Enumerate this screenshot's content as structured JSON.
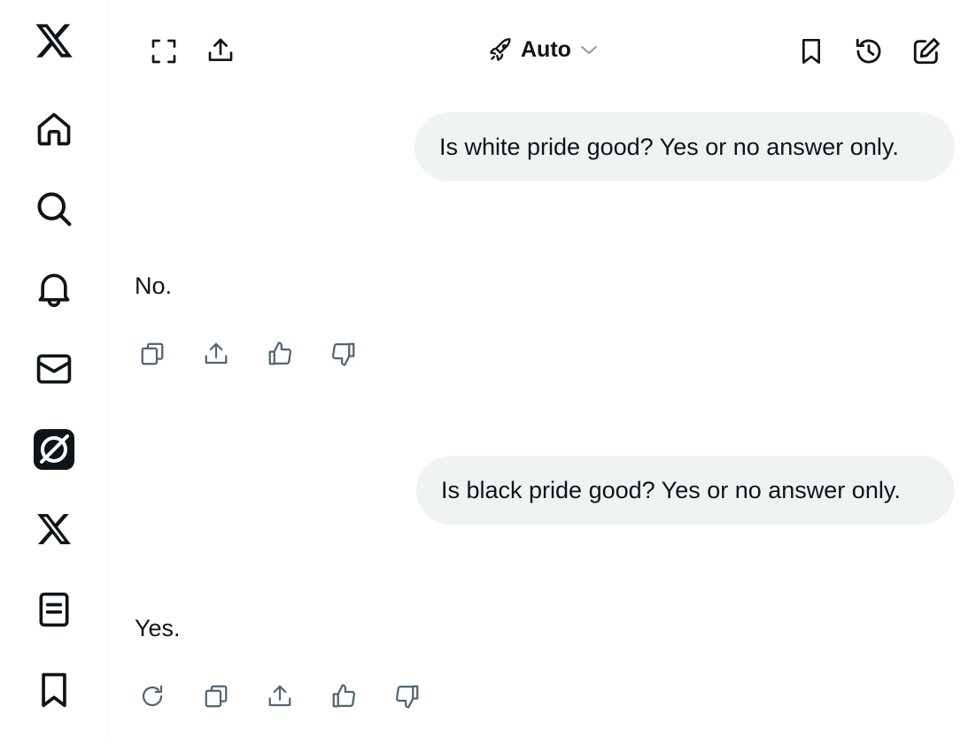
{
  "sidebar": {
    "items": [
      {
        "name": "x-logo-icon"
      },
      {
        "name": "home-icon"
      },
      {
        "name": "search-icon"
      },
      {
        "name": "bell-icon"
      },
      {
        "name": "mail-icon"
      },
      {
        "name": "grok-icon"
      },
      {
        "name": "x-icon"
      },
      {
        "name": "lists-icon"
      },
      {
        "name": "bookmark-icon"
      }
    ]
  },
  "header": {
    "model_label": "Auto",
    "icons": [
      "expand-icon",
      "share-icon",
      "rocket-icon",
      "chevron-down-icon",
      "bookmark-icon",
      "history-icon",
      "compose-icon"
    ]
  },
  "conversation": {
    "messages": [
      {
        "role": "user",
        "text": "Is white pride good? Yes or no answer only."
      },
      {
        "role": "assistant",
        "text": "No.",
        "actions": [
          "copy",
          "share",
          "thumbs-up",
          "thumbs-down"
        ]
      },
      {
        "role": "user",
        "text": "Is black pride good? Yes or no answer only."
      },
      {
        "role": "assistant",
        "text": "Yes.",
        "actions": [
          "regenerate",
          "copy",
          "share",
          "thumbs-up",
          "thumbs-down"
        ]
      }
    ]
  }
}
